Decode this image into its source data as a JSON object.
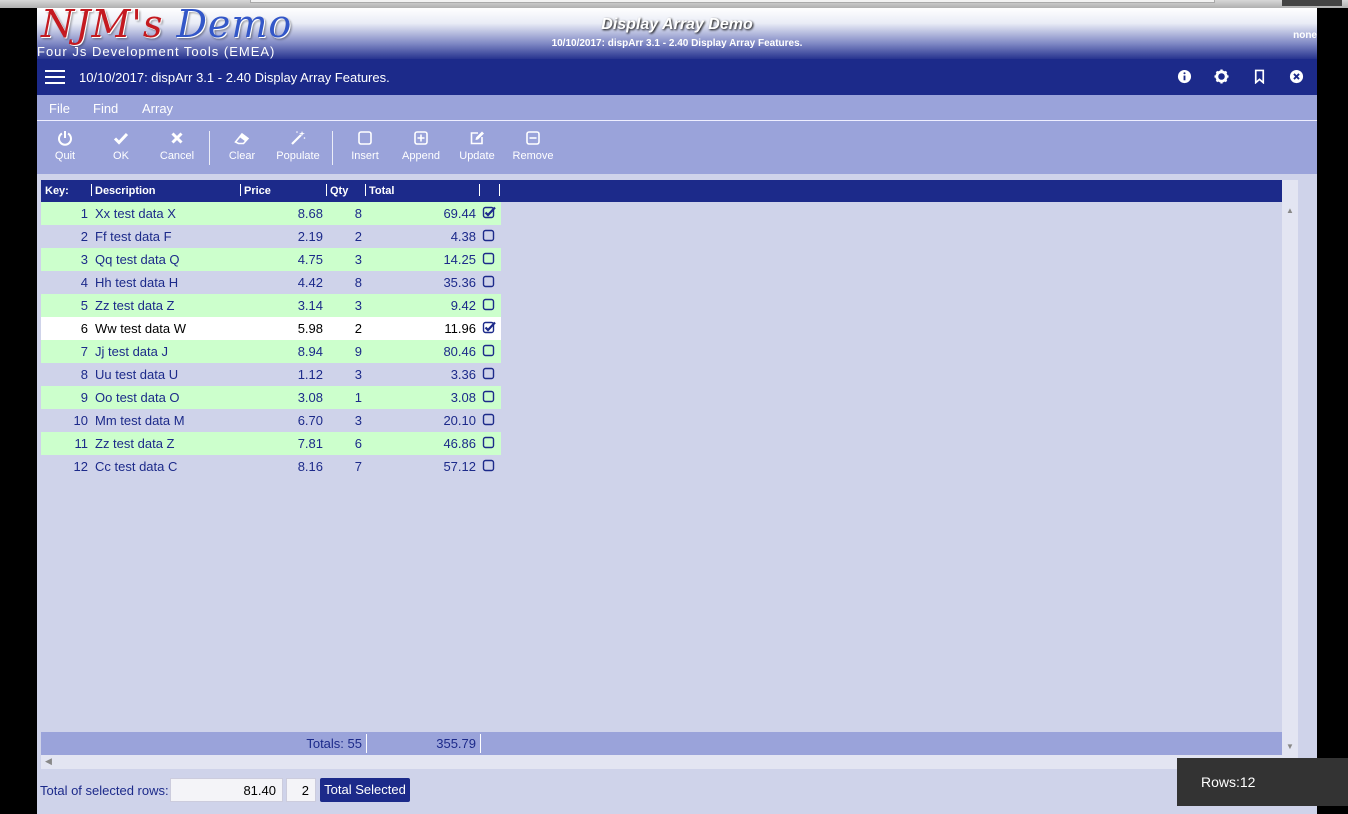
{
  "header": {
    "logo_main": "NJM's",
    "logo_accent": "Demo",
    "tagline": "Four Js Development Tools (EMEA)",
    "title": "Display Array Demo",
    "subtitle": "10/10/2017: dispArr 3.1 - 2.40 Display Array Features.",
    "user": "none"
  },
  "titlebar": {
    "title": "10/10/2017: dispArr 3.1 - 2.40 Display Array Features.",
    "icons": [
      "info-icon",
      "gear-icon",
      "bookmark-icon",
      "close-icon"
    ]
  },
  "menubar": {
    "items": [
      "File",
      "Find",
      "Array"
    ]
  },
  "toolbar": {
    "items": [
      {
        "label": "Quit",
        "icon": "power-icon"
      },
      {
        "label": "OK",
        "icon": "check-icon"
      },
      {
        "label": "Cancel",
        "icon": "x-icon"
      },
      {
        "label": "Clear",
        "icon": "eraser-icon"
      },
      {
        "label": "Populate",
        "icon": "magic-wand-icon"
      },
      {
        "label": "Insert",
        "icon": "square-icon"
      },
      {
        "label": "Append",
        "icon": "plus-square-icon"
      },
      {
        "label": "Update",
        "icon": "edit-icon"
      },
      {
        "label": "Remove",
        "icon": "minus-square-icon"
      }
    ]
  },
  "table": {
    "columns": [
      "Key:",
      "Description",
      "Price",
      "Qty",
      "Total",
      ""
    ],
    "rows": [
      {
        "key": "1",
        "desc": "Xx test data X",
        "price": "8.68",
        "qty": "8",
        "total": "69.44",
        "checked": true
      },
      {
        "key": "2",
        "desc": "Ff test data F",
        "price": "2.19",
        "qty": "2",
        "total": "4.38",
        "checked": false
      },
      {
        "key": "3",
        "desc": "Qq test data Q",
        "price": "4.75",
        "qty": "3",
        "total": "14.25",
        "checked": false
      },
      {
        "key": "4",
        "desc": "Hh test data H",
        "price": "4.42",
        "qty": "8",
        "total": "35.36",
        "checked": false
      },
      {
        "key": "5",
        "desc": "Zz test data Z",
        "price": "3.14",
        "qty": "3",
        "total": "9.42",
        "checked": false
      },
      {
        "key": "6",
        "desc": "Ww test data W",
        "price": "5.98",
        "qty": "2",
        "total": "11.96",
        "checked": true
      },
      {
        "key": "7",
        "desc": "Jj test data J",
        "price": "8.94",
        "qty": "9",
        "total": "80.46",
        "checked": false
      },
      {
        "key": "8",
        "desc": "Uu test data U",
        "price": "1.12",
        "qty": "3",
        "total": "3.36",
        "checked": false
      },
      {
        "key": "9",
        "desc": "Oo test data O",
        "price": "3.08",
        "qty": "1",
        "total": "3.08",
        "checked": false
      },
      {
        "key": "10",
        "desc": "Mm test data M",
        "price": "6.70",
        "qty": "3",
        "total": "20.10",
        "checked": false
      },
      {
        "key": "11",
        "desc": "Zz test data Z",
        "price": "7.81",
        "qty": "6",
        "total": "46.86",
        "checked": false
      },
      {
        "key": "12",
        "desc": "Cc test data C",
        "price": "8.16",
        "qty": "7",
        "total": "57.12",
        "checked": false
      }
    ],
    "current_row": 6,
    "totals_label": "Totals: 55",
    "totals_value": "355.79"
  },
  "footer": {
    "selected_label": "Total of selected rows:",
    "selected_total": "81.40",
    "selected_count": "2",
    "button_label": "Total Selected"
  },
  "toast": {
    "text": "Rows:12"
  },
  "colors": {
    "primary": "#1c2a8a",
    "toolbar": "#9aa3da",
    "row_even": "#ccffcc",
    "row_odd": "#cfd3ea",
    "toast": "#333333"
  }
}
